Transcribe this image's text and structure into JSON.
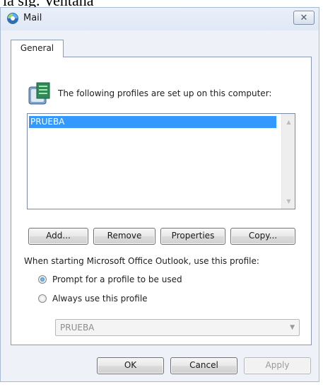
{
  "page_top_text": "la sig. Ventana",
  "window": {
    "title": "Mail",
    "close_label": "✕"
  },
  "tabs": [
    {
      "label": "General",
      "active": true
    }
  ],
  "profiles_label": "The following profiles are set up on this computer:",
  "profiles": [
    {
      "name": "PRUEBA",
      "selected": true
    }
  ],
  "profile_buttons": {
    "add": "Add...",
    "remove": "Remove",
    "properties": "Properties",
    "copy": "Copy..."
  },
  "startup": {
    "label": "When starting Microsoft Office Outlook, use this profile:",
    "options": [
      {
        "label": "Prompt for a profile to be used",
        "checked": true
      },
      {
        "label": "Always use this profile",
        "checked": false
      }
    ],
    "selected_profile": "PRUEBA"
  },
  "dialog_buttons": {
    "ok": "OK",
    "cancel": "Cancel",
    "apply": "Apply"
  }
}
